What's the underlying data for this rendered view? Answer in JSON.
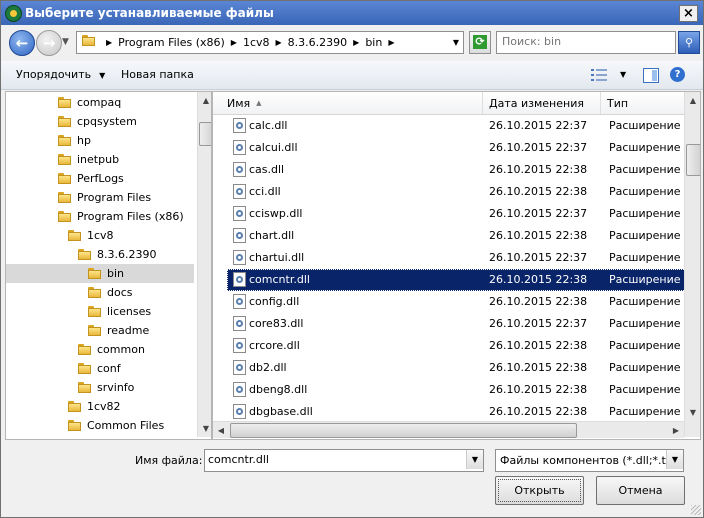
{
  "window": {
    "title": "Выберите устанавливаемые файлы",
    "close": "×"
  },
  "nav": {
    "back_glyph": "←",
    "forward_glyph": "→",
    "breadcrumb": [
      "Program Files (x86)",
      "1cv8",
      "8.3.6.2390",
      "bin"
    ],
    "search_placeholder": "Поиск: bin",
    "refresh_icon": "refresh-icon",
    "search_icon": "search-icon"
  },
  "toolbar": {
    "organize": "Упорядочить",
    "new_folder": "Новая папка"
  },
  "tree": {
    "items": [
      {
        "label": "compaq",
        "level": 0
      },
      {
        "label": "cpqsystem",
        "level": 0
      },
      {
        "label": "hp",
        "level": 0
      },
      {
        "label": "inetpub",
        "level": 0
      },
      {
        "label": "PerfLogs",
        "level": 0
      },
      {
        "label": "Program Files",
        "level": 0
      },
      {
        "label": "Program Files (x86)",
        "level": 0
      },
      {
        "label": "1cv8",
        "level": 1
      },
      {
        "label": "8.3.6.2390",
        "level": 2
      },
      {
        "label": "bin",
        "level": 3,
        "selected": true
      },
      {
        "label": "docs",
        "level": 3
      },
      {
        "label": "licenses",
        "level": 3
      },
      {
        "label": "readme",
        "level": 3
      },
      {
        "label": "common",
        "level": 2
      },
      {
        "label": "conf",
        "level": 2
      },
      {
        "label": "srvinfo",
        "level": 2
      },
      {
        "label": "1cv82",
        "level": 1
      },
      {
        "label": "Common Files",
        "level": 1
      }
    ]
  },
  "list": {
    "columns": [
      "Имя",
      "Дата изменения",
      "Тип"
    ],
    "rows": [
      {
        "name": "calc.dll",
        "date": "26.10.2015 22:37",
        "type": "Расширение пр"
      },
      {
        "name": "calcui.dll",
        "date": "26.10.2015 22:37",
        "type": "Расширение пр"
      },
      {
        "name": "cas.dll",
        "date": "26.10.2015 22:38",
        "type": "Расширение пр"
      },
      {
        "name": "cci.dll",
        "date": "26.10.2015 22:38",
        "type": "Расширение пр"
      },
      {
        "name": "cciswp.dll",
        "date": "26.10.2015 22:37",
        "type": "Расширение пр"
      },
      {
        "name": "chart.dll",
        "date": "26.10.2015 22:38",
        "type": "Расширение пр"
      },
      {
        "name": "chartui.dll",
        "date": "26.10.2015 22:37",
        "type": "Расширение пр"
      },
      {
        "name": "comcntr.dll",
        "date": "26.10.2015 22:38",
        "type": "Расширение пр",
        "selected": true
      },
      {
        "name": "config.dll",
        "date": "26.10.2015 22:38",
        "type": "Расширение пр"
      },
      {
        "name": "core83.dll",
        "date": "26.10.2015 22:37",
        "type": "Расширение пр"
      },
      {
        "name": "crcore.dll",
        "date": "26.10.2015 22:38",
        "type": "Расширение пр"
      },
      {
        "name": "db2.dll",
        "date": "26.10.2015 22:38",
        "type": "Расширение пр"
      },
      {
        "name": "dbeng8.dll",
        "date": "26.10.2015 22:38",
        "type": "Расширение пр"
      },
      {
        "name": "dbgbase.dll",
        "date": "26.10.2015 22:38",
        "type": "Расширение пр"
      }
    ]
  },
  "footer": {
    "filename_label": "Имя файла:",
    "filename_value": "comcntr.dll",
    "filter": "Файлы компонентов (*.dll;*.tlb",
    "open_button": "Открыть",
    "cancel_button": "Отмена"
  }
}
